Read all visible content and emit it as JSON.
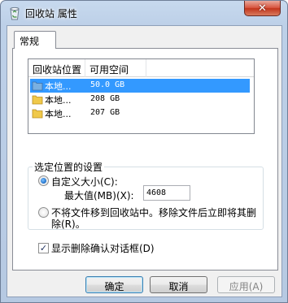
{
  "window": {
    "title": "回收站 属性",
    "close_glyph": "✕"
  },
  "tabs": [
    {
      "label": "常规"
    }
  ],
  "list": {
    "columns": [
      "回收站位置",
      "可用空间"
    ],
    "rows": [
      {
        "name": "本地...",
        "space": "50.0 GB",
        "selected": true
      },
      {
        "name": "本地...",
        "space": "208 GB",
        "selected": false
      },
      {
        "name": "本地...",
        "space": "207 GB",
        "selected": false
      }
    ]
  },
  "settings": {
    "group_title": "选定位置的设置",
    "custom_size_label": "自定义大小(C):",
    "max_value_label": "最大值(MB)(X):",
    "max_value": "4608",
    "no_move_label_line1": "不将文件移到回收站中。移除文件后立即将其删",
    "no_move_label_line2": "除(R)。",
    "confirm_label": "显示删除确认对话框(D)"
  },
  "buttons": {
    "ok": "确定",
    "cancel": "取消",
    "apply": "应用(A)"
  },
  "colors": {
    "selection": "#3399ff",
    "close_button": "#c7402a",
    "title_gradient": "#bdd0e8"
  },
  "icons": {
    "title": "recycle-bin-icon",
    "row": "folder-icon"
  }
}
